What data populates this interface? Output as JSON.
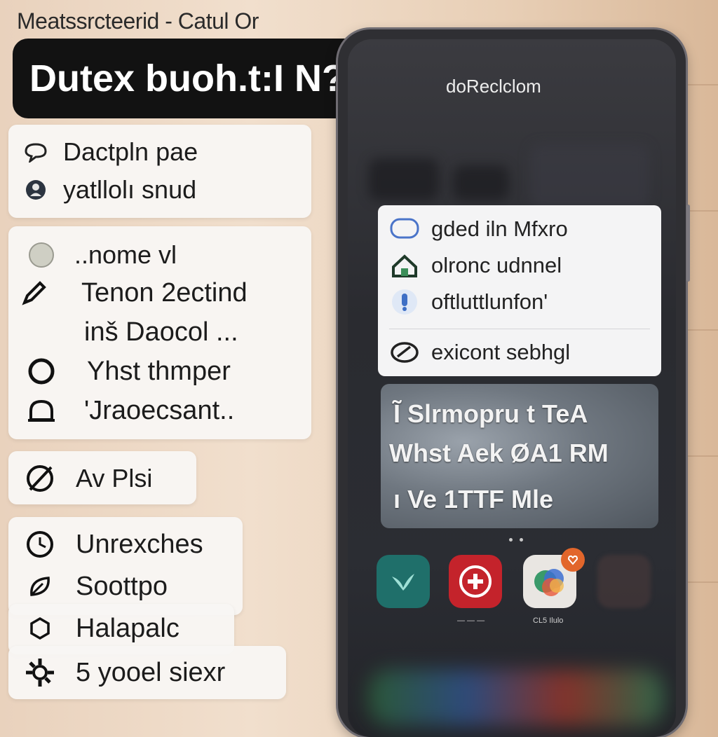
{
  "header": {
    "text": "Meatssrcteerid - Catul Or"
  },
  "banner": {
    "title": "Dutex buoh.t:I N?"
  },
  "panel_top": {
    "items": [
      {
        "label": "Dactpln pae",
        "icon": "speech-bubble-icon"
      },
      {
        "label": "yatllolı snud",
        "icon": "person-circle-icon"
      }
    ]
  },
  "panel_mid": {
    "items": [
      {
        "label": "..nome vl",
        "icon": "avatar-circle-icon"
      },
      {
        "label": "Tenon 2ectind",
        "icon": "pencil-icon"
      },
      {
        "label": "inš Daocol ...",
        "icon": ""
      },
      {
        "label": "Yhst thmper",
        "icon": "ring-icon"
      },
      {
        "label": "'Jraoecsant..",
        "icon": "bell-icon"
      }
    ]
  },
  "panel_small": {
    "label": "Av Plsi",
    "icon": "no-entry-icon"
  },
  "panel_bottom": {
    "items": [
      {
        "label": "Unrexches",
        "icon": "clock-icon"
      },
      {
        "label": "Soottpo",
        "icon": "leaf-icon"
      },
      {
        "label": "Halapalc",
        "icon": "hexagon-icon"
      },
      {
        "label": "5 yooel siexr",
        "icon": "gear-icon"
      }
    ]
  },
  "phone": {
    "title": "doReclclom",
    "menu": [
      {
        "label": "gded iln Mfxro",
        "icon": "chat-bubble-icon"
      },
      {
        "label": "olronc udnnel",
        "icon": "home-icon"
      },
      {
        "label": "oftluttlunfon'",
        "icon": "person-icon"
      },
      {
        "label": "exicont sebhgl",
        "icon": "edit-icon"
      }
    ],
    "notice": {
      "line1": "Ĩ Slrmopru t  TeA",
      "line2": "Whst Aek  ØA1  RM",
      "line3": "ı Ve   1TTF  Mle"
    },
    "apps": [
      {
        "name": "bird-app-icon",
        "label": ""
      },
      {
        "name": "plus-app-icon",
        "label": ""
      },
      {
        "name": "gallery-app-icon",
        "label": "CL5 Ilulo"
      }
    ]
  }
}
